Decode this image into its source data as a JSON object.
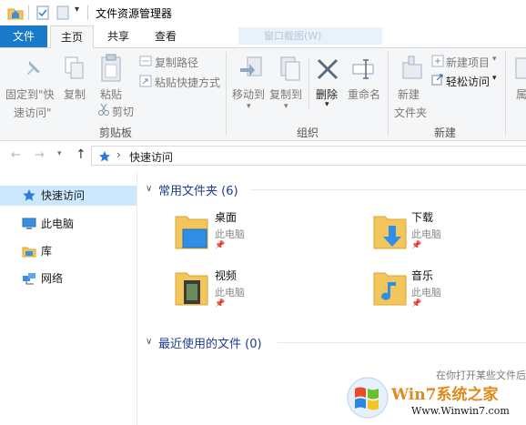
{
  "window": {
    "title": "文件资源管理器"
  },
  "tabs": {
    "file": "文件",
    "home": "主页",
    "share": "共享",
    "view": "查看",
    "ghost_title": "窗口截图(W)"
  },
  "ribbon": {
    "pin_quick_access": "固定到\"快",
    "pin_quick_access_2": "速访问\"",
    "copy": "复制",
    "paste": "粘贴",
    "copy_path": "复制路径",
    "paste_shortcut": "粘贴快捷方式",
    "cut": "剪切",
    "group_clipboard": "剪贴板",
    "move_to": "移动到",
    "copy_to": "复制到",
    "delete": "删除",
    "rename": "重命名",
    "group_organize": "组织",
    "new_folder": "新建",
    "new_folder_2": "文件夹",
    "new_item": "新建项目",
    "easy_access": "轻松访问",
    "group_new": "新建",
    "properties_partial": "属"
  },
  "address": {
    "path": "快速访问",
    "separator": "›"
  },
  "nav": {
    "items": [
      {
        "label": "快速访问"
      },
      {
        "label": "此电脑"
      },
      {
        "label": "库"
      },
      {
        "label": "网络"
      }
    ]
  },
  "content": {
    "frequent_header": "常用文件夹 (6)",
    "recent_header": "最近使用的文件 (0)",
    "folders": [
      {
        "name": "桌面",
        "location": "此电脑"
      },
      {
        "name": "下载",
        "location": "此电脑"
      },
      {
        "name": "视频",
        "location": "此电脑"
      },
      {
        "name": "音乐",
        "location": "此电脑"
      }
    ],
    "empty_hint": "在你打开某些文件后"
  },
  "watermark": {
    "brand": "Win7系统之家",
    "url": "Www.Winwin7.com"
  },
  "colors": {
    "accent": "#1979ca",
    "folder": "#f2c65c",
    "selected": "#cce8ff"
  }
}
